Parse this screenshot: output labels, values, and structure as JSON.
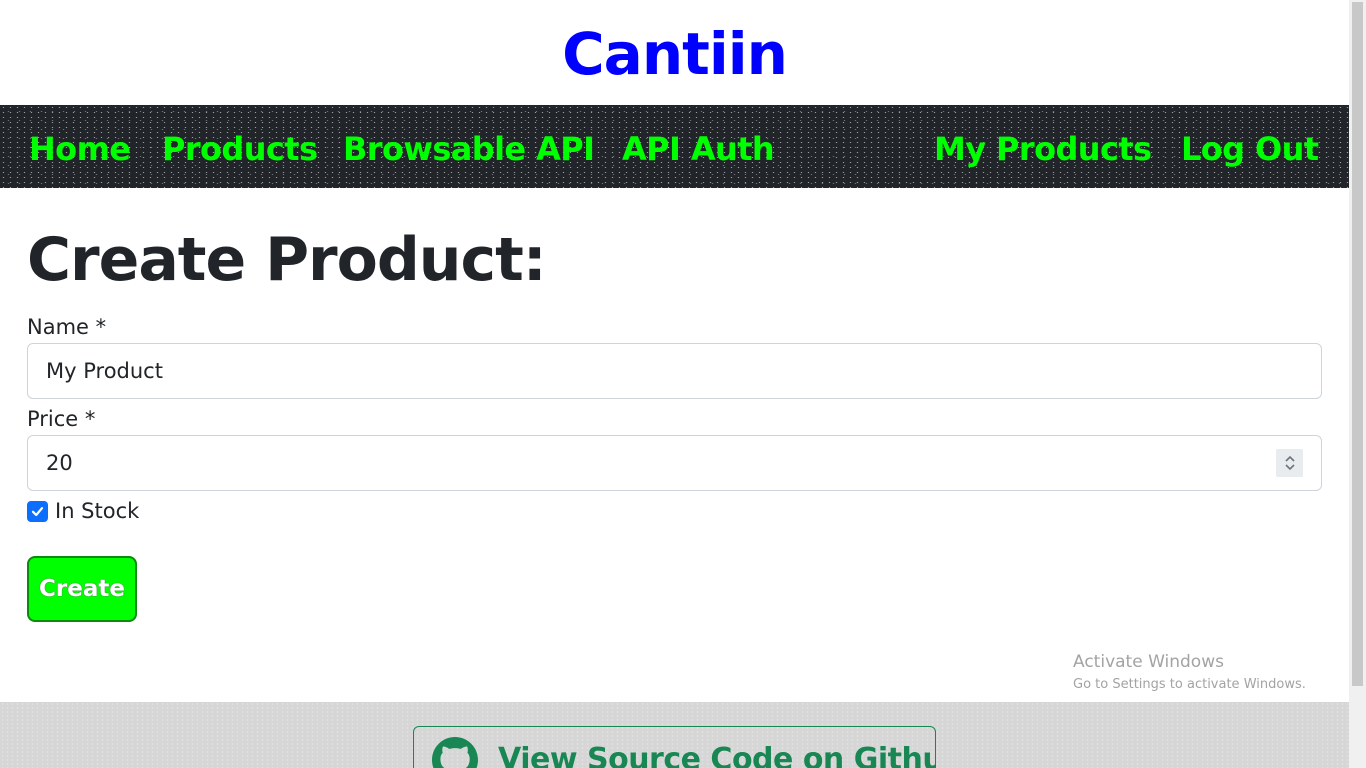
{
  "brand": {
    "title": "Cantiin",
    "color": "#0000ff"
  },
  "nav": {
    "left": [
      {
        "label": "Home"
      },
      {
        "label": "Products"
      },
      {
        "label": "Browsable API"
      },
      {
        "label": "API Auth"
      }
    ],
    "right": [
      {
        "label": "My Products"
      },
      {
        "label": "Log Out"
      }
    ],
    "link_color": "#00ff00",
    "background": "#212529"
  },
  "form": {
    "title": "Create Product:",
    "name_label": "Name *",
    "name_value": "My Product",
    "price_label": "Price *",
    "price_value": "20",
    "in_stock_label": "In Stock",
    "in_stock_checked": true,
    "submit_label": "Create",
    "submit_color": "#00ff00"
  },
  "watermark": {
    "title": "Activate Windows",
    "subtitle": "Go to Settings to activate Windows."
  },
  "footer": {
    "github_label": "View Source Code on Github",
    "github_icon": "github-icon",
    "accent": "#198754"
  }
}
